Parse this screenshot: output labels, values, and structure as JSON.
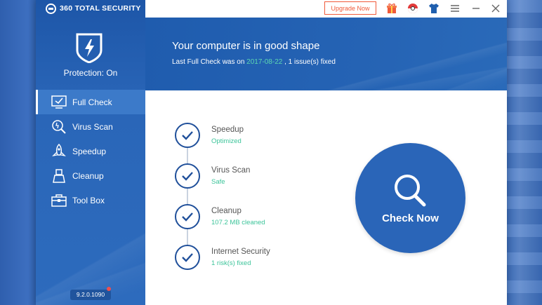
{
  "app": {
    "brand_name": "360 TOTAL SECURITY",
    "protection_status": "Protection: On",
    "version": "9.2.0.1090"
  },
  "titlebar": {
    "upgrade_label": "Upgrade Now",
    "icons": [
      "gift-icon",
      "skin-icon",
      "shirt-icon",
      "menu-icon",
      "minimize-icon",
      "close-icon"
    ]
  },
  "sidebar": {
    "items": [
      {
        "label": "Full Check",
        "icon": "monitor-check-icon",
        "active": true
      },
      {
        "label": "Virus Scan",
        "icon": "virus-scan-icon",
        "active": false
      },
      {
        "label": "Speedup",
        "icon": "rocket-icon",
        "active": false
      },
      {
        "label": "Cleanup",
        "icon": "broom-icon",
        "active": false
      },
      {
        "label": "Tool Box",
        "icon": "toolbox-icon",
        "active": false
      }
    ]
  },
  "banner": {
    "title": "Your computer is in good shape",
    "sub_prefix": "Last Full Check was on",
    "sub_date": "2017-08-22",
    "sub_suffix": ", 1 issue(s) fixed"
  },
  "checks": [
    {
      "title": "Speedup",
      "status": "Optimized"
    },
    {
      "title": "Virus Scan",
      "status": "Safe"
    },
    {
      "title": "Cleanup",
      "status": "107.2 MB cleaned"
    },
    {
      "title": "Internet Security",
      "status": "1 risk(s) fixed"
    }
  ],
  "check_now": {
    "label": "Check Now"
  },
  "colors": {
    "sidebar_blue": "#2a66b8",
    "accent_green": "#3cc49a",
    "upgrade_orange": "#f05a3a",
    "check_now_blue": "#2a65b8"
  }
}
